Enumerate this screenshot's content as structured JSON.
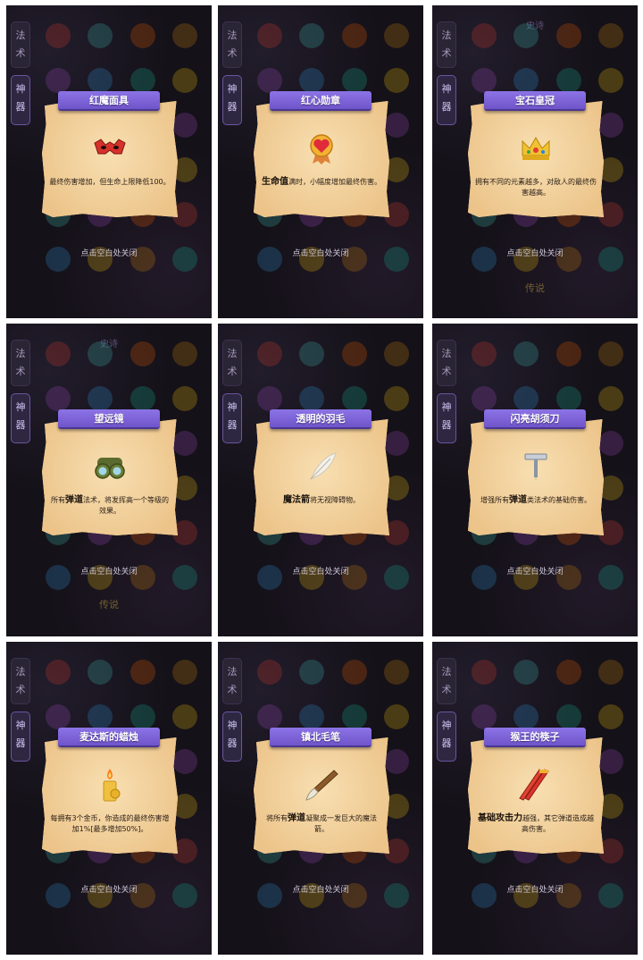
{
  "tabs": {
    "spell": "法术",
    "artifact": "神器"
  },
  "section_labels": {
    "epic": "史诗",
    "legend": "传说"
  },
  "close_hint": "点击空白处关闭",
  "dialogs": [
    {
      "title": "红魔面具",
      "icon": "red-devil-mask-icon",
      "desc": "最终伤害增加，但生命上限降低100。"
    },
    {
      "title": "红心勋章",
      "icon": "red-heart-medal-icon",
      "desc_bold": "生命值",
      "desc": "满时，小幅度增加最终伤害。"
    },
    {
      "title": "宝石皇冠",
      "icon": "gem-crown-icon",
      "desc": "拥有不同的元素越多，对敌人的最终伤害越高。"
    },
    {
      "title": "望远镜",
      "icon": "binoculars-icon",
      "desc_prefix": "所有",
      "desc_bold": "弹道",
      "desc": "法术，将发挥高一个等级的效果。"
    },
    {
      "title": "透明的羽毛",
      "icon": "transparent-feather-icon",
      "desc_bold": "魔法箭",
      "desc": "将无视障碍物。"
    },
    {
      "title": "闪亮胡须刀",
      "icon": "shiny-razor-icon",
      "desc_prefix": "增强所有",
      "desc_bold": "弹道",
      "desc": "类法术的基础伤害。"
    },
    {
      "title": "麦达斯的蜡烛",
      "icon": "midas-candle-icon",
      "desc": "每拥有3个金币，你造成的最终伤害增加1%[最多增加50%]。"
    },
    {
      "title": "镇北毛笔",
      "icon": "zhenbei-brush-icon",
      "desc_prefix": "将所有",
      "desc_bold": "弹道",
      "desc": "凝聚成一发巨大的魔法箭。"
    },
    {
      "title": "猴王的筷子",
      "icon": "monkey-king-chopsticks-icon",
      "desc_bold": "基础攻击力",
      "desc": "越强，其它弹道造成越高伤害。"
    }
  ],
  "colors": {
    "banner": "#7a60d8",
    "parchment": "#f2cf98",
    "background": "#141118"
  }
}
